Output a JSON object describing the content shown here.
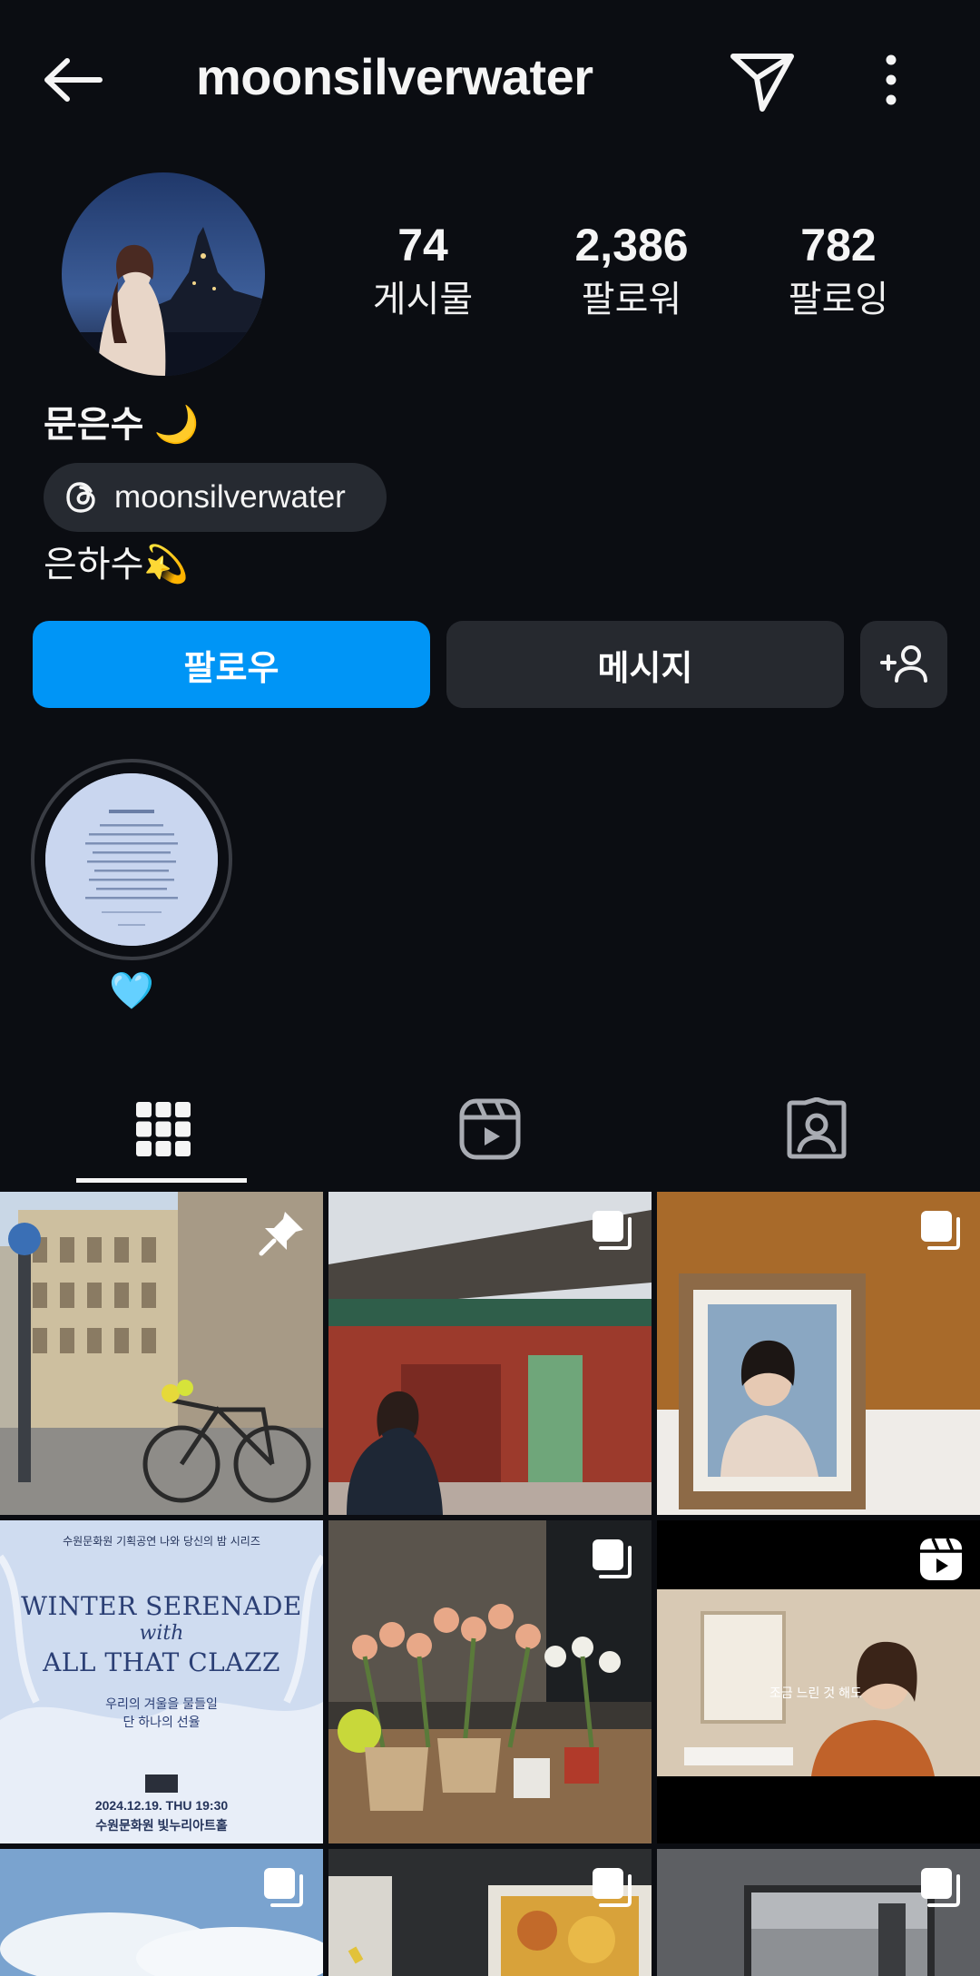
{
  "header": {
    "username": "moonsilverwater",
    "back_icon": "arrow-left-icon",
    "send_icon": "paper-plane-icon",
    "more_icon": "more-vertical-icon"
  },
  "profile": {
    "name": "문은수 🌙",
    "threads_handle": "moonsilverwater",
    "bio": "은하수💫",
    "stats": [
      {
        "value": "74",
        "label": "게시물"
      },
      {
        "value": "2,386",
        "label": "팔로워"
      },
      {
        "value": "782",
        "label": "팔로잉"
      }
    ]
  },
  "actions": {
    "follow_label": "팔로우",
    "message_label": "메시지",
    "follow_color": "#0095f6"
  },
  "highlights": [
    {
      "label": "🩵"
    }
  ],
  "tabs": [
    {
      "name": "grid",
      "icon": "grid-icon",
      "active": true
    },
    {
      "name": "reels",
      "icon": "reels-icon",
      "active": false
    },
    {
      "name": "tagged",
      "icon": "tagged-person-icon",
      "active": false
    }
  ],
  "grid": {
    "posts": [
      {
        "badge": "pin-icon"
      },
      {
        "badge": "carousel-icon"
      },
      {
        "badge": "carousel-icon"
      },
      {
        "badge": "none",
        "poster_line1": "수원문화원 기획공연 나와 당신의 밤 시리즈",
        "poster_title1": "WINTER SERENADE",
        "poster_with": "with",
        "poster_title2": "ALL THAT CLAZZ",
        "poster_sub1": "우리의 겨울을 물들일",
        "poster_sub2": "단 하나의 선율",
        "poster_date": "2024.12.19. THU 19:30",
        "poster_venue": "수원문화원 빛누리아트홀"
      },
      {
        "badge": "carousel-icon"
      },
      {
        "badge": "reels-icon",
        "caption": "조금 느린 것 해도"
      },
      {
        "badge": "carousel-icon"
      },
      {
        "badge": "carousel-icon"
      },
      {
        "badge": "carousel-icon"
      }
    ]
  }
}
